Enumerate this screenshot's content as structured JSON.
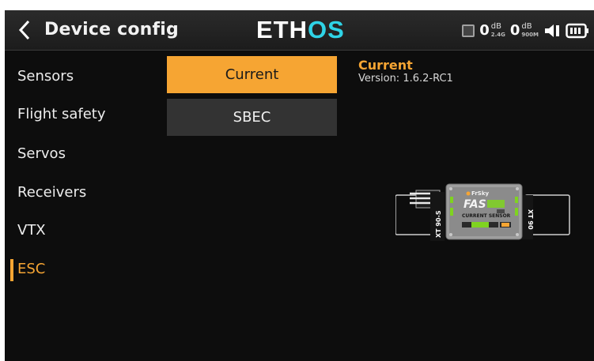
{
  "header": {
    "title": "Device config",
    "logo_left": "ETH",
    "logo_right": "OS",
    "rf": [
      {
        "value": "0",
        "unit": "dB",
        "band": "2.4G"
      },
      {
        "value": "0",
        "unit": "dB",
        "band": "900M"
      }
    ],
    "icons": [
      "back-chevron-icon",
      "rf-module-icon",
      "speaker-icon",
      "battery-icon"
    ]
  },
  "sidebar": {
    "items": [
      {
        "label": "Sensors"
      },
      {
        "label": "Flight safety"
      },
      {
        "label": "Servos"
      },
      {
        "label": "Receivers"
      },
      {
        "label": "VTX"
      },
      {
        "label": "ESC"
      }
    ],
    "active": "ESC"
  },
  "list": {
    "items": [
      {
        "label": "Current"
      },
      {
        "label": "SBEC"
      }
    ],
    "selected": "Current"
  },
  "info": {
    "title": "Current",
    "version": "Version: 1.6.2-RC1"
  },
  "device": {
    "left_label": "XT 90-S",
    "right_label": "XT 90",
    "brand": "FrSky",
    "model": "FAS",
    "caption": "CURRENT SENSOR"
  },
  "colors": {
    "accent": "#f6a533",
    "logo_accent": "#2fd3e6",
    "background": "#0d0d0d",
    "button": "#333333"
  }
}
